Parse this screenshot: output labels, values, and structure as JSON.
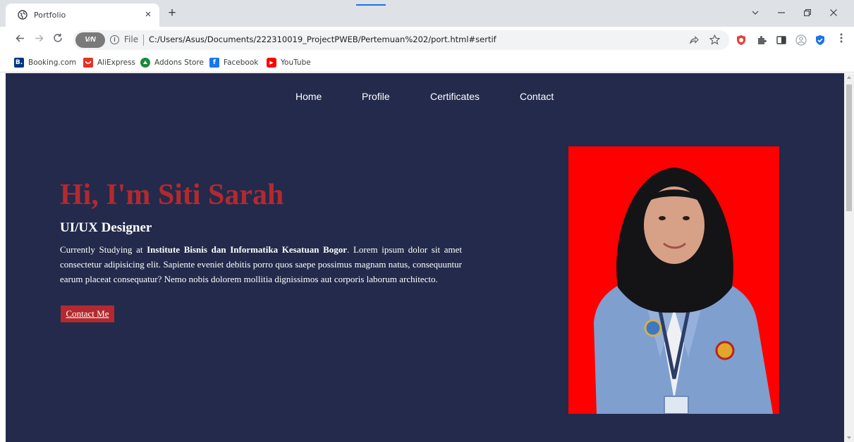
{
  "browser": {
    "tab_title": "Portfolio",
    "close_glyph": "×",
    "new_tab_glyph": "+",
    "address": {
      "vpn_label": "V⁄N",
      "scheme_label": "File",
      "url": "C:/Users/Asus/Documents/222310019_ProjectPWEB/Pertemuan%202/port.html#sertif"
    },
    "bookmarks": [
      {
        "label": "Booking.com",
        "icon": "booking-icon",
        "color": "#003580",
        "glyph": "B."
      },
      {
        "label": "AliExpress",
        "icon": "aliexpress-icon",
        "color": "#e43225",
        "glyph": ""
      },
      {
        "label": "Addons Store",
        "icon": "addons-store-icon",
        "color": "#1b8a3a",
        "glyph": ""
      },
      {
        "label": "Facebook",
        "icon": "facebook-icon",
        "color": "#1877f2",
        "glyph": "f"
      },
      {
        "label": "YouTube",
        "icon": "youtube-icon",
        "color": "#ff0000",
        "glyph": "▶"
      }
    ]
  },
  "page": {
    "background": "#232a4b",
    "accent": "#b3292f",
    "nav": [
      {
        "label": "Home"
      },
      {
        "label": "Profile"
      },
      {
        "label": "Certificates"
      },
      {
        "label": "Contact"
      }
    ],
    "hero": {
      "title": "Hi, I'm Siti Sarah",
      "role": "UI/UX Designer",
      "desc_prefix": "Currently Studying at ",
      "desc_bold": "Institute Bisnis dan Informatika Kesatuan Bogor",
      "desc_rest": ". Lorem ipsum dolor sit amet consectetur adipisicing elit. Sapiente eveniet debitis porro quos saepe possimus magnam natus, consequuntur earum placeat consequatur? Nemo nobis dolorem mollitia dignissimos aut corporis laborum architecto.",
      "cta": "Contact Me"
    },
    "photo_background": "#fe0000"
  }
}
